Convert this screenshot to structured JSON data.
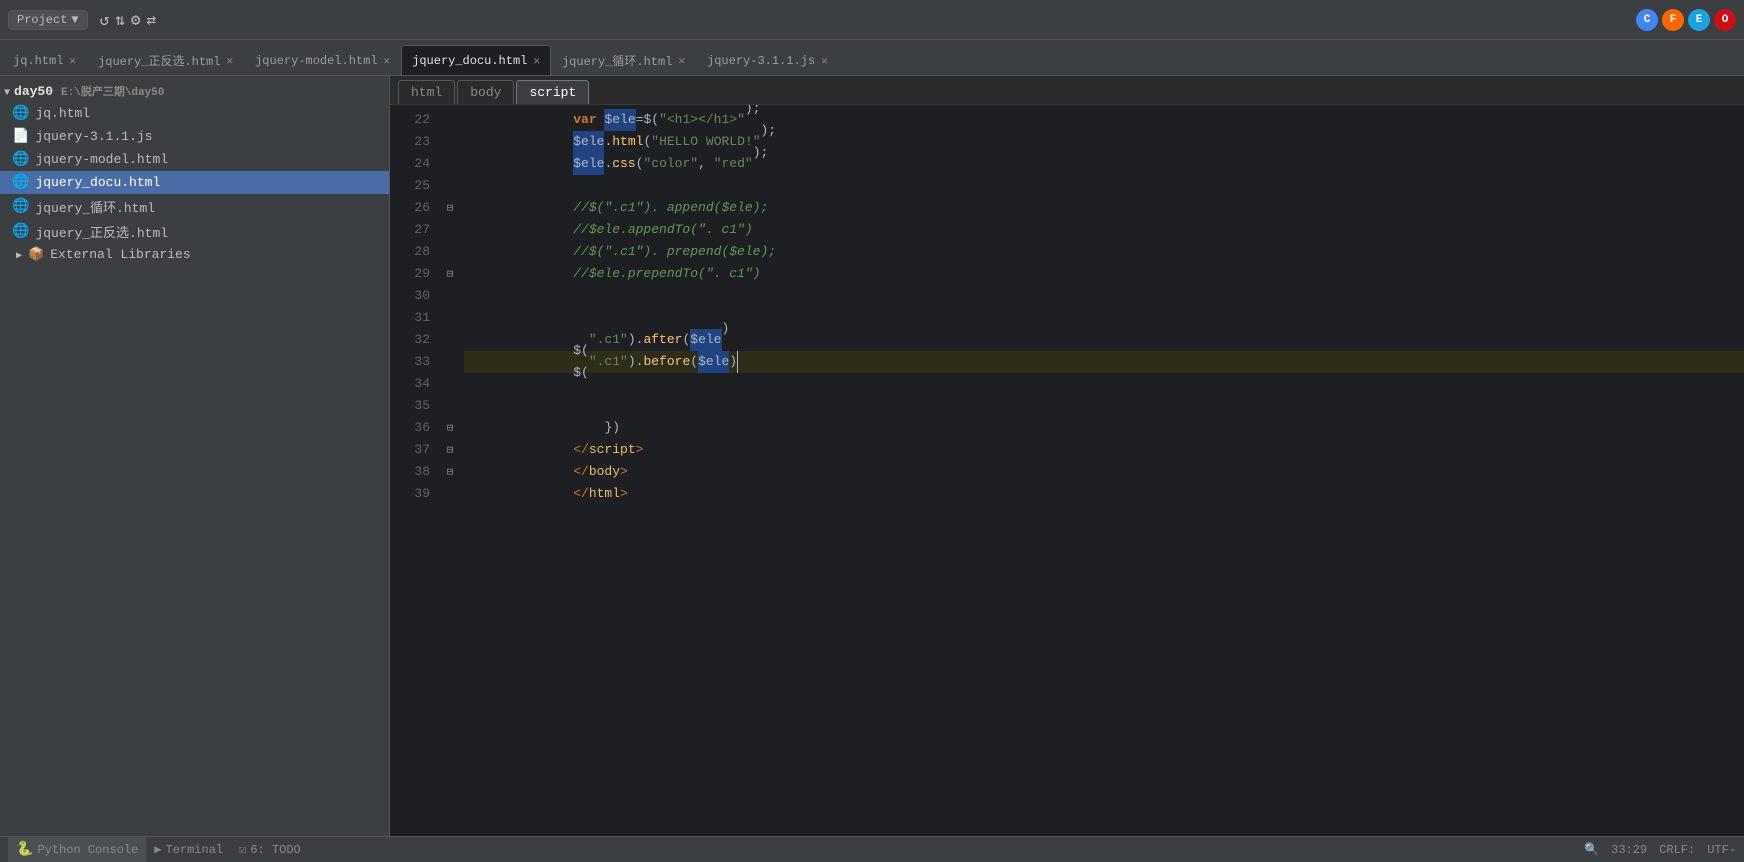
{
  "topbar": {
    "project_label": "Project",
    "dropdown_arrow": "▼",
    "icons": [
      "↺",
      "⇅",
      "⚙",
      "⇄"
    ]
  },
  "tabs": [
    {
      "id": "jq",
      "label": "jq.html",
      "active": false
    },
    {
      "id": "jquery_pos",
      "label": "jquery_正反选.html",
      "active": false
    },
    {
      "id": "jquery_model",
      "label": "jquery-model.html",
      "active": false
    },
    {
      "id": "jquery_docu",
      "label": "jquery_docu.html",
      "active": true
    },
    {
      "id": "jquery_loop",
      "label": "jquery_循环.html",
      "active": false
    },
    {
      "id": "jquery_311",
      "label": "jquery-3.1.1.js",
      "active": false
    }
  ],
  "breadcrumbs": [
    "html",
    "body",
    "script"
  ],
  "sidebar": {
    "project_path": "E:\\脱产三期\\day50",
    "root_label": "day50",
    "items": [
      {
        "id": "jq",
        "label": "jq.html",
        "icon": "🌐",
        "type": "html"
      },
      {
        "id": "jquery311",
        "label": "jquery-3.1.1.js",
        "icon": "📄",
        "type": "js"
      },
      {
        "id": "jquery_model",
        "label": "jquery-model.html",
        "icon": "🌐",
        "type": "html"
      },
      {
        "id": "jquery_docu",
        "label": "jquery_docu.html",
        "icon": "🌐",
        "type": "html",
        "selected": true
      },
      {
        "id": "jquery_loop",
        "label": "jquery_循环.html",
        "icon": "🌐",
        "type": "html"
      },
      {
        "id": "jquery_pos",
        "label": "jquery_正反选.html",
        "icon": "🌐",
        "type": "html"
      }
    ],
    "ext_libraries_label": "External Libraries"
  },
  "code": {
    "lines": [
      {
        "num": 22,
        "indent": 2,
        "content_html": "    <span class='kw'>var</span> <span class='highlight-var'>$ele</span><span>=</span><span class='fn'>$(</span><span class='str'>\"&lt;h1&gt;&lt;/h1&gt;\"</span><span class='fn'>)</span><span>;</span>",
        "gutter": ""
      },
      {
        "num": 23,
        "indent": 2,
        "content_html": "    <span class='highlight-var'>$ele</span><span>.</span><span class='fn'>html</span><span>(</span><span class='str'>\"HELLO WORLD!\"</span><span>);</span>",
        "gutter": ""
      },
      {
        "num": 24,
        "indent": 2,
        "content_html": "    <span class='highlight-var'>$ele</span><span>.</span><span class='fn'>css</span><span>(</span><span class='str'>\"color\"</span><span>, </span><span class='str'>\"red\"</span><span>);</span>",
        "gutter": ""
      },
      {
        "num": 25,
        "indent": 0,
        "content_html": "",
        "gutter": ""
      },
      {
        "num": 26,
        "indent": 2,
        "content_html": "    <span class='comment'>//$(\"<span class='selector'>.c1</span>\"). append($ele);</span>",
        "gutter": "fold"
      },
      {
        "num": 27,
        "indent": 2,
        "content_html": "    <span class='comment'>//$ele.appendTo(\". c1\")</span>",
        "gutter": ""
      },
      {
        "num": 28,
        "indent": 2,
        "content_html": "    <span class='comment'>//$(\"<span class='selector'>.c1</span>\"). prepend($ele);</span>",
        "gutter": ""
      },
      {
        "num": 29,
        "indent": 2,
        "content_html": "    <span class='comment'>//$ele.prependTo(\". c1\")</span>",
        "gutter": "fold"
      },
      {
        "num": 30,
        "indent": 0,
        "content_html": "",
        "gutter": ""
      },
      {
        "num": 31,
        "indent": 0,
        "content_html": "",
        "gutter": ""
      },
      {
        "num": 32,
        "indent": 2,
        "content_html": "    <span class='fn'>$(</span><span class='str'>\".c1\"</span><span class='fn'>)</span><span>.</span><span class='fn'>after</span><span>(</span><span class='highlight-var'>$ele</span><span>)</span>",
        "gutter": ""
      },
      {
        "num": 33,
        "indent": 2,
        "content_html": "    <span class='fn'>$(</span><span class='str'>\".c1\"</span><span class='fn'>)</span><span>.</span><span class='fn'>before</span><span>(</span><span class='highlight-var'>$ele</span><span>)</span>",
        "gutter": "",
        "current": true
      },
      {
        "num": 34,
        "indent": 0,
        "content_html": "",
        "gutter": ""
      },
      {
        "num": 35,
        "indent": 0,
        "content_html": "",
        "gutter": ""
      },
      {
        "num": 36,
        "indent": 1,
        "content_html": "        <span class='paren'>})</span>",
        "gutter": "fold"
      },
      {
        "num": 37,
        "indent": 0,
        "content_html": "    <span class='tag-angle'>&lt;/</span><span class='tag-name'>script</span><span class='tag-angle'>&gt;</span>",
        "gutter": "fold"
      },
      {
        "num": 38,
        "indent": 0,
        "content_html": "    <span class='tag-angle'>&lt;/</span><span class='tag-name'>body</span><span class='tag-angle'>&gt;</span>",
        "gutter": "fold"
      },
      {
        "num": 39,
        "indent": 0,
        "content_html": "    <span class='tag-angle'>&lt;/</span><span class='tag-name'>html</span><span class='tag-angle'>&gt;</span>",
        "gutter": ""
      }
    ]
  },
  "statusbar": {
    "python_console_label": "Python Console",
    "terminal_label": "Terminal",
    "todo_label": "6: TODO",
    "right_position": "33:29",
    "line_ending": "CRLF:",
    "encoding": "UTF-"
  }
}
